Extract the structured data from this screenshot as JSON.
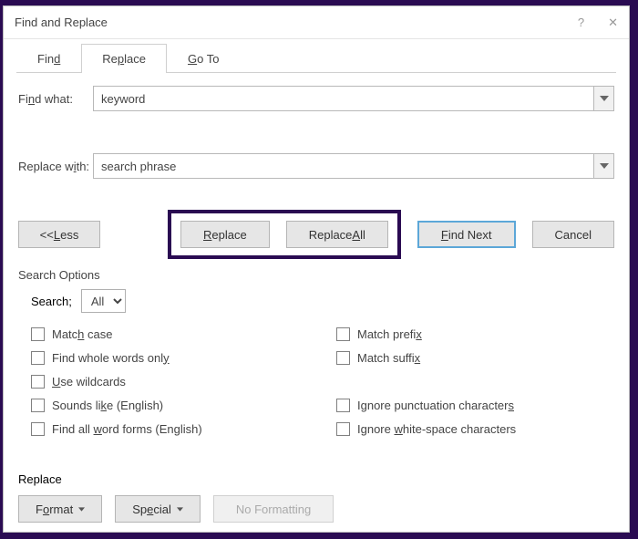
{
  "window": {
    "title": "Find and Replace"
  },
  "tabs": {
    "find": "Find",
    "replace": "Replace",
    "goto": "Go To"
  },
  "findRow": {
    "label": "Find what:",
    "value": "keyword"
  },
  "replaceRow": {
    "label": "Replace with:",
    "value": "search phrase"
  },
  "buttons": {
    "less": "<< Less",
    "replace": "Replace",
    "replaceAll": "Replace All",
    "findNext": "Find Next",
    "cancel": "Cancel"
  },
  "options": {
    "legend": "Search Options",
    "searchLabel": "Search;",
    "searchValue": "All",
    "left": {
      "matchCase": "Match case",
      "wholeWords": "Find whole words only",
      "wildcards": "Use wildcards",
      "soundsLike": "Sounds like (English)",
      "wordForms": "Find all word forms (English)"
    },
    "right": {
      "matchPrefix": "Match prefix",
      "matchSuffix": "Match suffix",
      "ignorePunct": "Ignore punctuation characters",
      "ignoreWhite": "Ignore white-space characters"
    }
  },
  "bottom": {
    "legend": "Replace",
    "format": "Format",
    "special": "Special",
    "noFormatting": "No Formatting"
  }
}
